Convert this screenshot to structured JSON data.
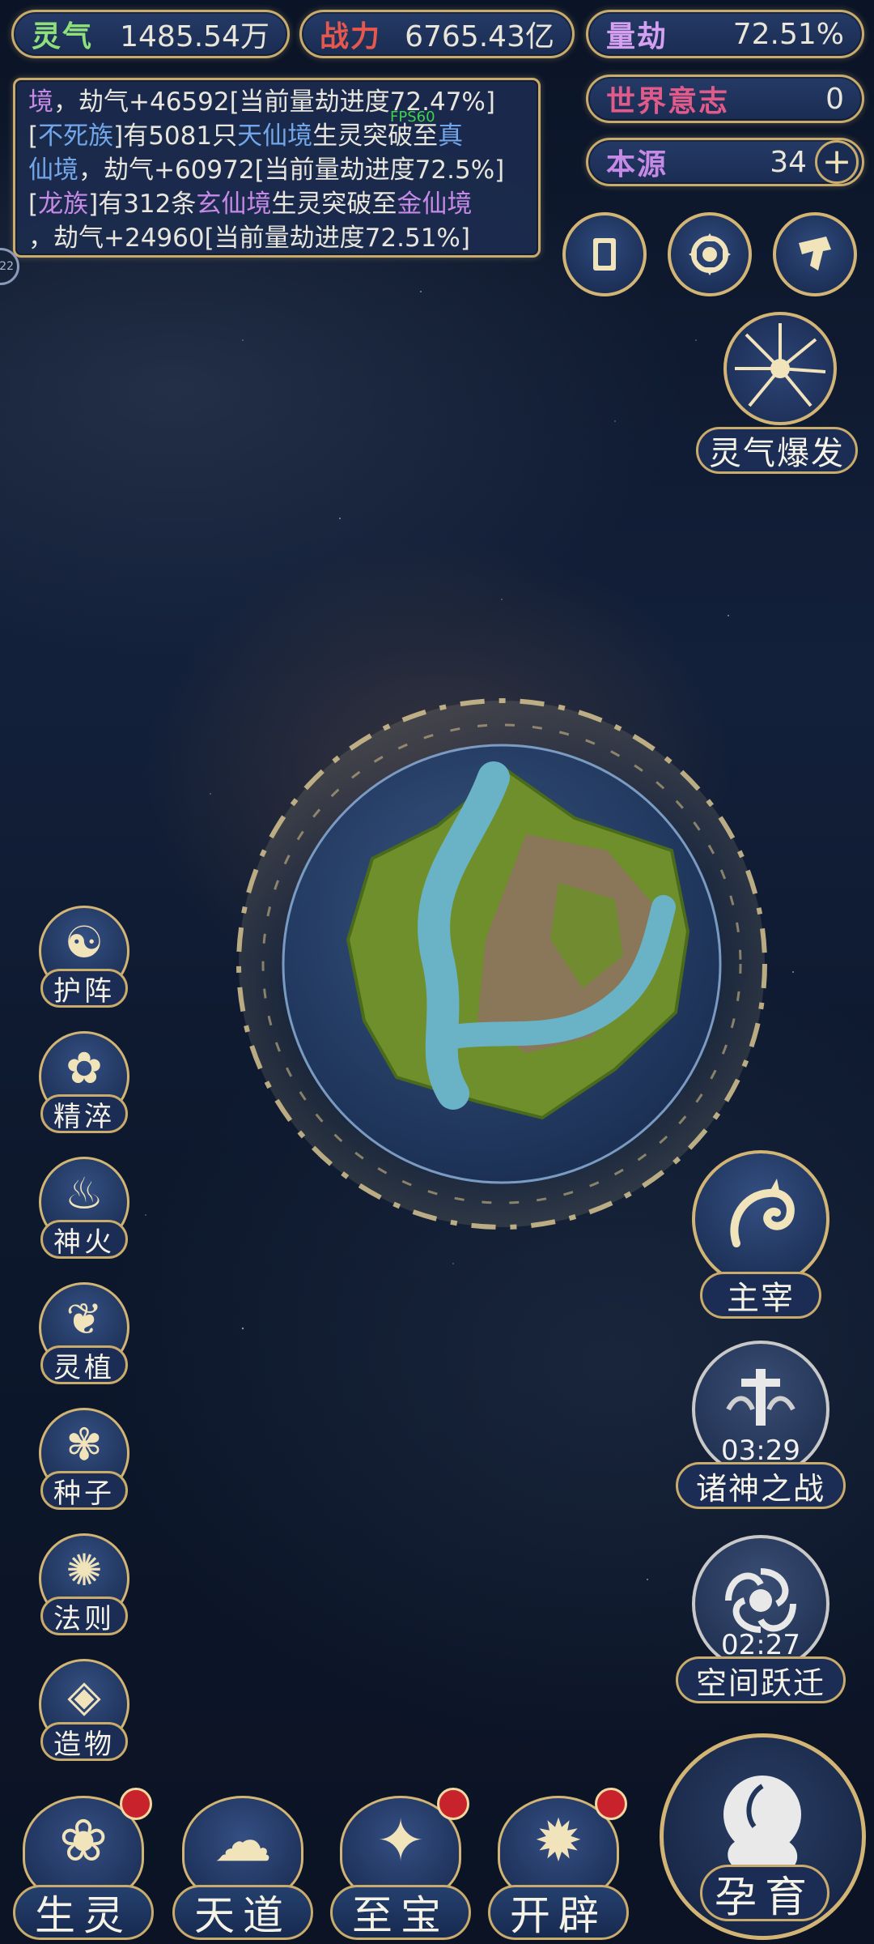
{
  "top_stats": {
    "lingqi": {
      "label": "灵气",
      "value": "1485.54万"
    },
    "zhanli": {
      "label": "战力",
      "value": "6765.43亿"
    },
    "liangjie": {
      "label": "量劫",
      "value": "72.51%"
    },
    "shijie": {
      "label": "世界意志",
      "value": "0"
    },
    "benyuan": {
      "label": "本源",
      "value": "34",
      "plus": "+"
    }
  },
  "log": {
    "line1": {
      "a": "境",
      "b": "，劫气+46592[当前量劫进度72.47%]"
    },
    "line2": {
      "a": "[",
      "race": "不死族",
      "b": "]有5081只",
      "from": "天仙境",
      "c": "生灵突破至",
      "to": "真"
    },
    "line3": {
      "to": "仙境",
      "b": "，劫气+60972[当前量劫进度72.5%]"
    },
    "line4": {
      "a": "[",
      "race": "龙族",
      "b": "]有312条",
      "from": "玄仙境",
      "c": "生灵突破至",
      "to": "金仙境"
    },
    "line5": {
      "b": "，劫气+24960[当前量劫进度72.51%]"
    }
  },
  "fps": "FPS60",
  "edge_indicator": "22",
  "burst": {
    "label": "灵气爆发"
  },
  "left_menu": [
    {
      "label": "护阵",
      "icon": "yin-yang-icon"
    },
    {
      "label": "精淬",
      "icon": "lotus-flame-icon"
    },
    {
      "label": "神火",
      "icon": "fire-icon"
    },
    {
      "label": "灵植",
      "icon": "plant-icon"
    },
    {
      "label": "种子",
      "icon": "seed-flower-icon"
    },
    {
      "label": "法则",
      "icon": "rune-icon"
    },
    {
      "label": "造物",
      "icon": "creation-diamond-icon"
    }
  ],
  "right_menu": {
    "zhuzai": {
      "label": "主宰"
    },
    "zhushen": {
      "label": "诸神之战",
      "timer": "03:29"
    },
    "kongjian": {
      "label": "空间跃迁",
      "timer": "02:27"
    }
  },
  "bottom_nav": [
    {
      "label": "生灵",
      "badge": true
    },
    {
      "label": "天道",
      "badge": false
    },
    {
      "label": "至宝",
      "badge": true
    },
    {
      "label": "开辟",
      "badge": true
    }
  ],
  "yunyu": {
    "label": "孕育"
  },
  "colors": {
    "gold": "#c9ab6b",
    "panel": "#1b2d54",
    "purple": "#c58ae6",
    "blue": "#72a6e8",
    "red_badge": "#c8232c"
  }
}
